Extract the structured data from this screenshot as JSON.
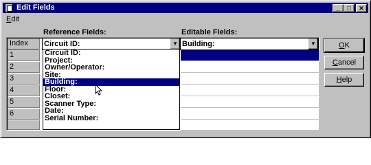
{
  "window": {
    "title": "Edit Fields",
    "controls": {
      "minimize": "_",
      "maximize": "□",
      "close": "✕"
    }
  },
  "menu": {
    "edit_label_accel": "E",
    "edit_label_rest": "dit"
  },
  "labels": {
    "reference_fields": "Reference Fields:",
    "editable_fields": "Editable Fields:"
  },
  "grid": {
    "index_header": "Index",
    "row_numbers": [
      "1",
      "2",
      "3",
      "4",
      "5",
      "6"
    ]
  },
  "reference_combo": {
    "value": "Circuit ID:"
  },
  "editable_combo": {
    "value": "Building:"
  },
  "dropdown": {
    "items": [
      "Circuit ID:",
      "Project:",
      "Owner/Operator:",
      "Site:",
      "Building:",
      "Floor:",
      "Closet:",
      "Scanner Type:",
      "Date:",
      "Serial Number:"
    ],
    "selected_index": 4
  },
  "buttons": {
    "ok_accel": "O",
    "ok_rest": "K",
    "cancel_accel": "C",
    "cancel_rest": "ancel",
    "help_accel": "H",
    "help_rest": "elp"
  },
  "colors": {
    "selection": "#000080",
    "face": "#c0c0c0"
  }
}
